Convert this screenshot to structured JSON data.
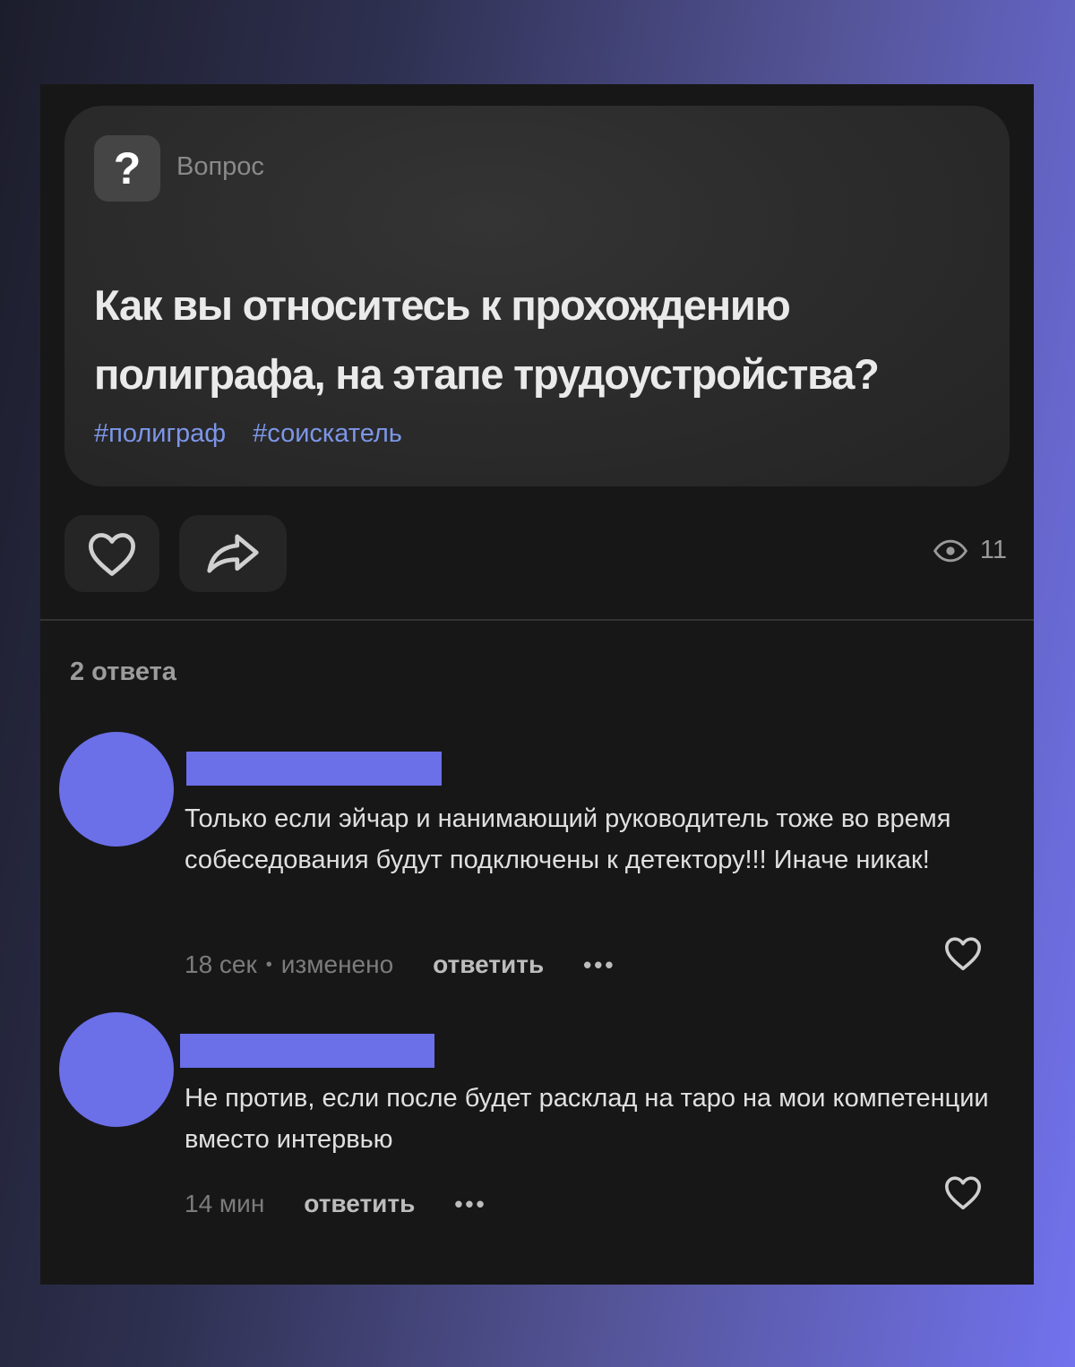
{
  "question": {
    "badge_glyph": "?",
    "label": "Вопрос",
    "title": "Как вы относитесь к прохождению полиграфа, на этапе трудоустройства?",
    "tags": [
      "#полиграф",
      "#соискатель"
    ]
  },
  "actions": {
    "like_icon": "heart-outline-icon",
    "share_icon": "share-arrow-icon",
    "views_icon": "eye-icon",
    "views_count": "11"
  },
  "answers_header": "2 ответа",
  "answers": [
    {
      "text": "Только если эйчар и нанимающий руководитель тоже во время собеседования будут подключены к детектору!!! Иначе никак!",
      "time": "18 сек",
      "separator": "•",
      "edited": "изменено",
      "reply_label": "ответить",
      "more_label": "•••"
    },
    {
      "text": "Не против, если после будет расклад на таро на мои компетенции вместо интервью",
      "time": "14 мин",
      "reply_label": "ответить",
      "more_label": "•••"
    }
  ],
  "colors": {
    "accent": "#6b6fe8",
    "tag": "#7c96e8",
    "card_bg": "#2c2c2c",
    "screen_bg": "#171717"
  }
}
